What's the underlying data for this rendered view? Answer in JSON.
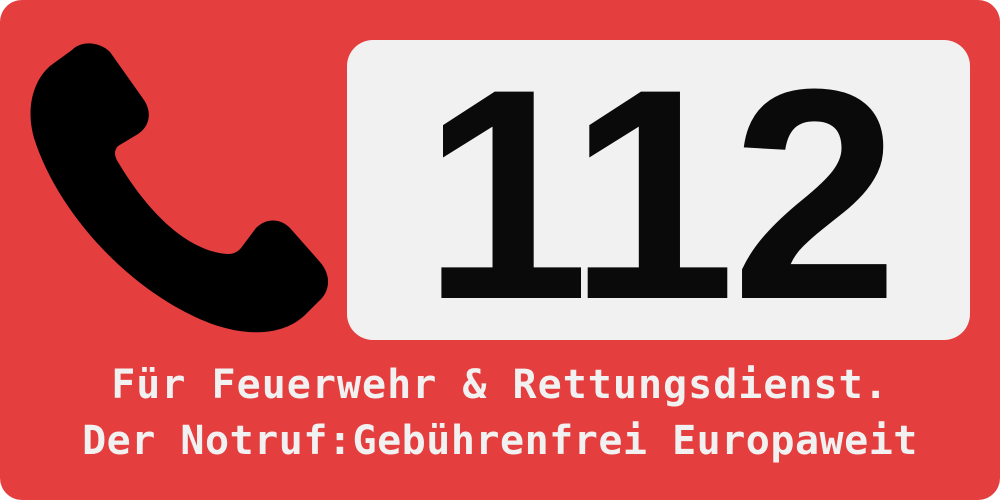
{
  "sign": {
    "number": "112",
    "line1": "Für Feuerwehr & Rettungsdienst.",
    "line2": "Der Notruf:Gebührenfrei Europaweit",
    "icon": "phone-icon",
    "colors": {
      "background": "#e53e3e",
      "box": "#f1f1f1",
      "number": "#0a0a0a",
      "text": "#f1f1f1"
    }
  }
}
